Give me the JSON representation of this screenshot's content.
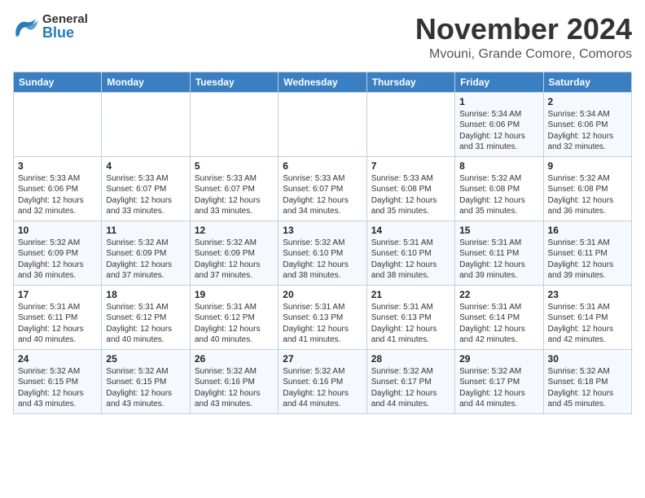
{
  "header": {
    "logo_general": "General",
    "logo_blue": "Blue",
    "month": "November 2024",
    "location": "Mvouni, Grande Comore, Comoros"
  },
  "days_of_week": [
    "Sunday",
    "Monday",
    "Tuesday",
    "Wednesday",
    "Thursday",
    "Friday",
    "Saturday"
  ],
  "weeks": [
    [
      {
        "day": "",
        "info": ""
      },
      {
        "day": "",
        "info": ""
      },
      {
        "day": "",
        "info": ""
      },
      {
        "day": "",
        "info": ""
      },
      {
        "day": "",
        "info": ""
      },
      {
        "day": "1",
        "info": "Sunrise: 5:34 AM\nSunset: 6:06 PM\nDaylight: 12 hours and 31 minutes."
      },
      {
        "day": "2",
        "info": "Sunrise: 5:34 AM\nSunset: 6:06 PM\nDaylight: 12 hours and 32 minutes."
      }
    ],
    [
      {
        "day": "3",
        "info": "Sunrise: 5:33 AM\nSunset: 6:06 PM\nDaylight: 12 hours and 32 minutes."
      },
      {
        "day": "4",
        "info": "Sunrise: 5:33 AM\nSunset: 6:07 PM\nDaylight: 12 hours and 33 minutes."
      },
      {
        "day": "5",
        "info": "Sunrise: 5:33 AM\nSunset: 6:07 PM\nDaylight: 12 hours and 33 minutes."
      },
      {
        "day": "6",
        "info": "Sunrise: 5:33 AM\nSunset: 6:07 PM\nDaylight: 12 hours and 34 minutes."
      },
      {
        "day": "7",
        "info": "Sunrise: 5:33 AM\nSunset: 6:08 PM\nDaylight: 12 hours and 35 minutes."
      },
      {
        "day": "8",
        "info": "Sunrise: 5:32 AM\nSunset: 6:08 PM\nDaylight: 12 hours and 35 minutes."
      },
      {
        "day": "9",
        "info": "Sunrise: 5:32 AM\nSunset: 6:08 PM\nDaylight: 12 hours and 36 minutes."
      }
    ],
    [
      {
        "day": "10",
        "info": "Sunrise: 5:32 AM\nSunset: 6:09 PM\nDaylight: 12 hours and 36 minutes."
      },
      {
        "day": "11",
        "info": "Sunrise: 5:32 AM\nSunset: 6:09 PM\nDaylight: 12 hours and 37 minutes."
      },
      {
        "day": "12",
        "info": "Sunrise: 5:32 AM\nSunset: 6:09 PM\nDaylight: 12 hours and 37 minutes."
      },
      {
        "day": "13",
        "info": "Sunrise: 5:32 AM\nSunset: 6:10 PM\nDaylight: 12 hours and 38 minutes."
      },
      {
        "day": "14",
        "info": "Sunrise: 5:31 AM\nSunset: 6:10 PM\nDaylight: 12 hours and 38 minutes."
      },
      {
        "day": "15",
        "info": "Sunrise: 5:31 AM\nSunset: 6:11 PM\nDaylight: 12 hours and 39 minutes."
      },
      {
        "day": "16",
        "info": "Sunrise: 5:31 AM\nSunset: 6:11 PM\nDaylight: 12 hours and 39 minutes."
      }
    ],
    [
      {
        "day": "17",
        "info": "Sunrise: 5:31 AM\nSunset: 6:11 PM\nDaylight: 12 hours and 40 minutes."
      },
      {
        "day": "18",
        "info": "Sunrise: 5:31 AM\nSunset: 6:12 PM\nDaylight: 12 hours and 40 minutes."
      },
      {
        "day": "19",
        "info": "Sunrise: 5:31 AM\nSunset: 6:12 PM\nDaylight: 12 hours and 40 minutes."
      },
      {
        "day": "20",
        "info": "Sunrise: 5:31 AM\nSunset: 6:13 PM\nDaylight: 12 hours and 41 minutes."
      },
      {
        "day": "21",
        "info": "Sunrise: 5:31 AM\nSunset: 6:13 PM\nDaylight: 12 hours and 41 minutes."
      },
      {
        "day": "22",
        "info": "Sunrise: 5:31 AM\nSunset: 6:14 PM\nDaylight: 12 hours and 42 minutes."
      },
      {
        "day": "23",
        "info": "Sunrise: 5:31 AM\nSunset: 6:14 PM\nDaylight: 12 hours and 42 minutes."
      }
    ],
    [
      {
        "day": "24",
        "info": "Sunrise: 5:32 AM\nSunset: 6:15 PM\nDaylight: 12 hours and 43 minutes."
      },
      {
        "day": "25",
        "info": "Sunrise: 5:32 AM\nSunset: 6:15 PM\nDaylight: 12 hours and 43 minutes."
      },
      {
        "day": "26",
        "info": "Sunrise: 5:32 AM\nSunset: 6:16 PM\nDaylight: 12 hours and 43 minutes."
      },
      {
        "day": "27",
        "info": "Sunrise: 5:32 AM\nSunset: 6:16 PM\nDaylight: 12 hours and 44 minutes."
      },
      {
        "day": "28",
        "info": "Sunrise: 5:32 AM\nSunset: 6:17 PM\nDaylight: 12 hours and 44 minutes."
      },
      {
        "day": "29",
        "info": "Sunrise: 5:32 AM\nSunset: 6:17 PM\nDaylight: 12 hours and 44 minutes."
      },
      {
        "day": "30",
        "info": "Sunrise: 5:32 AM\nSunset: 6:18 PM\nDaylight: 12 hours and 45 minutes."
      }
    ]
  ]
}
